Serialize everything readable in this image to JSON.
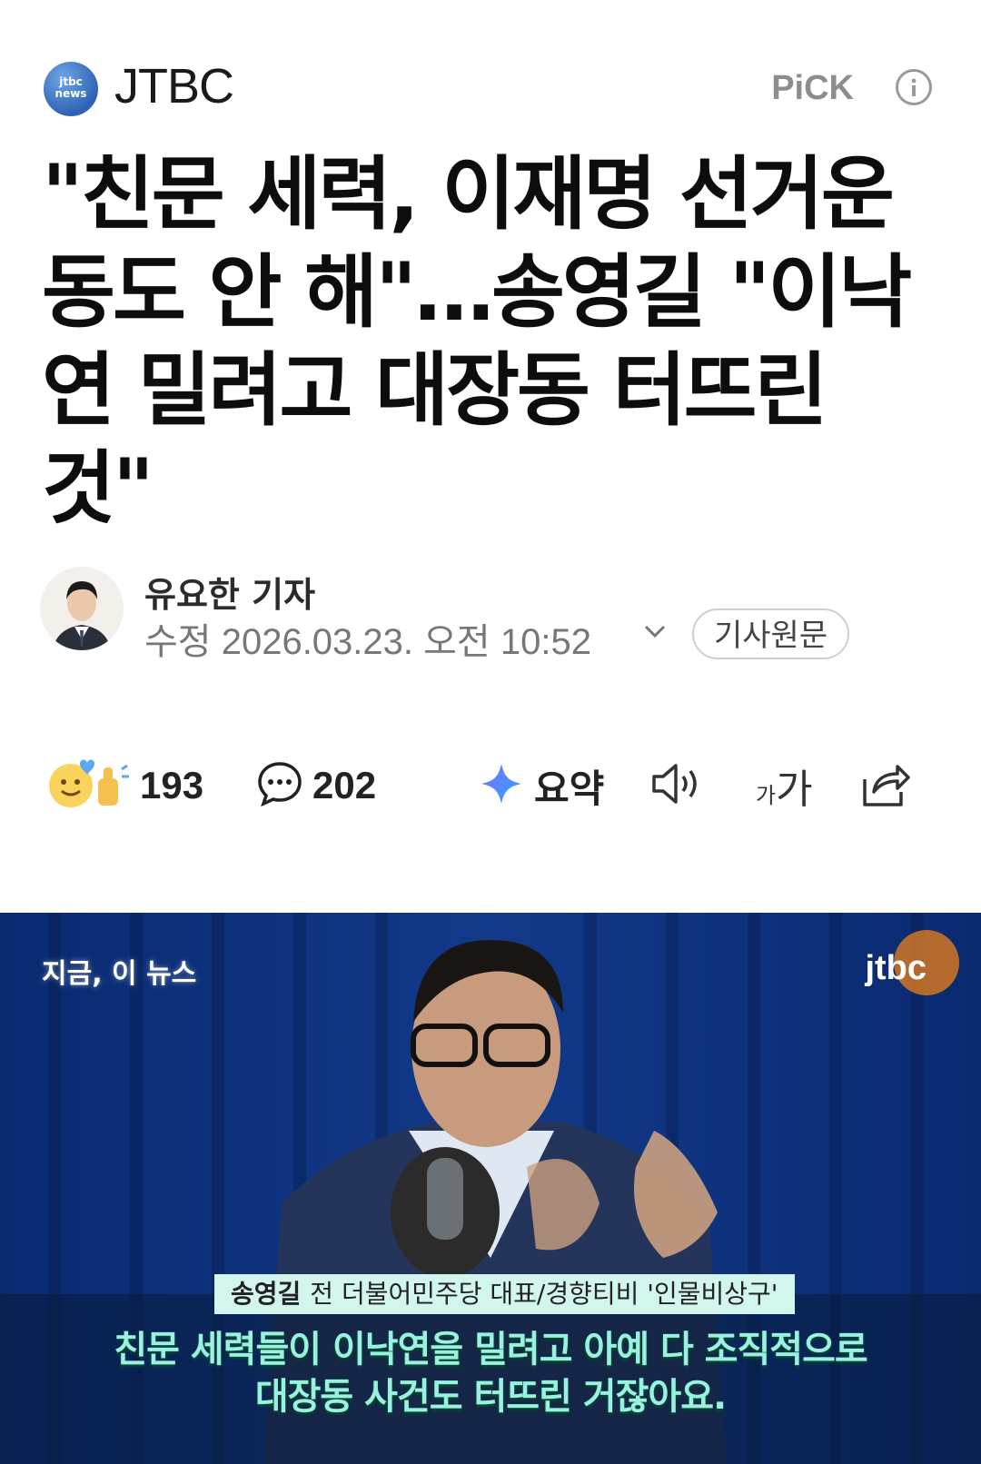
{
  "header": {
    "logo_text": "jtbc news",
    "brand": "JTBC",
    "pick_label": "PiCK"
  },
  "article": {
    "headline": "\"친문 세력, 이재명 선거운동도 안 해\"…송영길 \"이낙연 밀려고 대장동 터뜨린 것\"",
    "reporter": "유요한 기자",
    "modified": "수정 2026.03.23. 오전 10:52",
    "original_button": "기사원문"
  },
  "actions": {
    "reactions_count": "193",
    "comments_count": "202",
    "summary_label": "요약",
    "font_size_icon_label": "가가"
  },
  "video": {
    "section_tag": "지금, 이 뉴스",
    "channel_mark": "jtbc",
    "speaker_name": "송영길",
    "speaker_title": "전 더불어민주당 대표/경향티비 '인물비상구'",
    "caption_line1": "친문 세력들이 이낙연을 밀려고 아예 다 조직적으로",
    "caption_line2": "대장동 사건도 터뜨린 거잖아요."
  },
  "colors": {
    "accent_blue": "#2e64b3",
    "caption_green": "#9af0e2",
    "video_bg": "#0c2a66"
  }
}
